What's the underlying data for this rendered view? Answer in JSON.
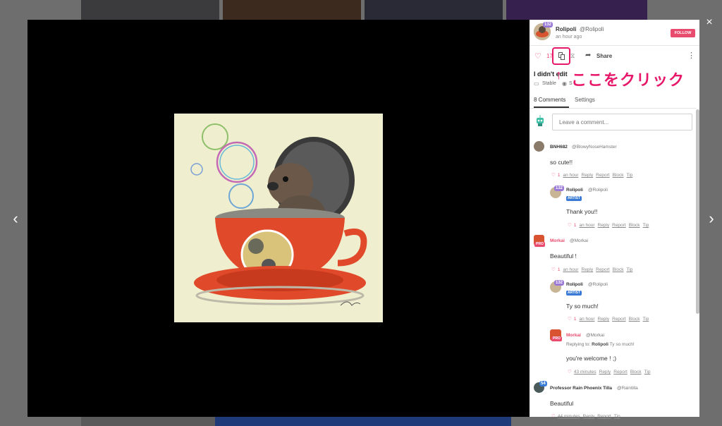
{
  "modal": {
    "close_icon": "×",
    "prev_icon": "‹",
    "next_icon": "›"
  },
  "post": {
    "author_name": "Rolipoli",
    "author_handle": "@Rolipoli",
    "author_level": "132",
    "time": "an hour ago",
    "follow_label": "FOLLOW",
    "like_count": "17",
    "share_label": "Share",
    "title": "I didn't edit",
    "model_1": "Stable",
    "model_2": "S"
  },
  "annotation": {
    "arrow": "↑",
    "text": "ここをクリック",
    "color": "#e7186a"
  },
  "tabs": {
    "comments": "8 Comments",
    "settings": "Settings"
  },
  "comment_input": {
    "placeholder": "Leave a comment..."
  },
  "comments": [
    {
      "name": "BNH682",
      "handle": "@BlowyNoseHamster",
      "body": "so cute!!",
      "likes": "1",
      "time": "an hour",
      "reply": "Reply",
      "report": "Report",
      "block": "Block",
      "tip": "Tip",
      "reply_item": {
        "name": "Rolipoli",
        "handle": "@Rolipoli",
        "level": "132",
        "badge": "ARTIST",
        "body": "Thank you!!",
        "likes": "1",
        "time": "an hour",
        "reply": "Reply",
        "report": "Report",
        "block": "Block",
        "tip": "Tip"
      }
    },
    {
      "name": "Morkai",
      "handle": "@Morkai",
      "badge": "PRO",
      "body": "Beautiful !",
      "likes": "1",
      "time": "an hour",
      "reply": "Reply",
      "report": "Report",
      "block": "Block",
      "tip": "Tip",
      "reply_items": [
        {
          "name": "Rolipoli",
          "handle": "@Rolipoli",
          "level": "132",
          "badge": "ARTIST",
          "body": "Ty so much!",
          "likes": "1",
          "time": "an hour",
          "reply": "Reply",
          "report": "Report",
          "block": "Block",
          "tip": "Tip"
        },
        {
          "name": "Morkai",
          "handle": "@Morkai",
          "badge": "PRO",
          "replying_label": "Replying to:",
          "replying_name": "Rolipoli",
          "replying_quote": "Ty so much!",
          "body": "you're welcome ! ;)",
          "time": "43 minutes",
          "reply": "Reply",
          "report": "Report",
          "block": "Block",
          "tip": "Tip"
        }
      ]
    },
    {
      "name": "Professor Rain Phoenix Tilla",
      "handle": "@Raintilla",
      "level": "54",
      "body": "Beautiful",
      "time": "44 minutes",
      "reply": "Reply",
      "report": "Report",
      "tip": "Tip"
    }
  ],
  "icons": {
    "like": "heart-icon",
    "copy": "copy-icon",
    "remix": "remix-icon",
    "share": "share-icon",
    "more": "more-vertical-icon",
    "close": "close-icon"
  },
  "colors": {
    "accent": "#e94b6e",
    "annotation": "#e7186a",
    "artist_badge": "#3a7bd5",
    "viewer_bg": "#000000"
  }
}
